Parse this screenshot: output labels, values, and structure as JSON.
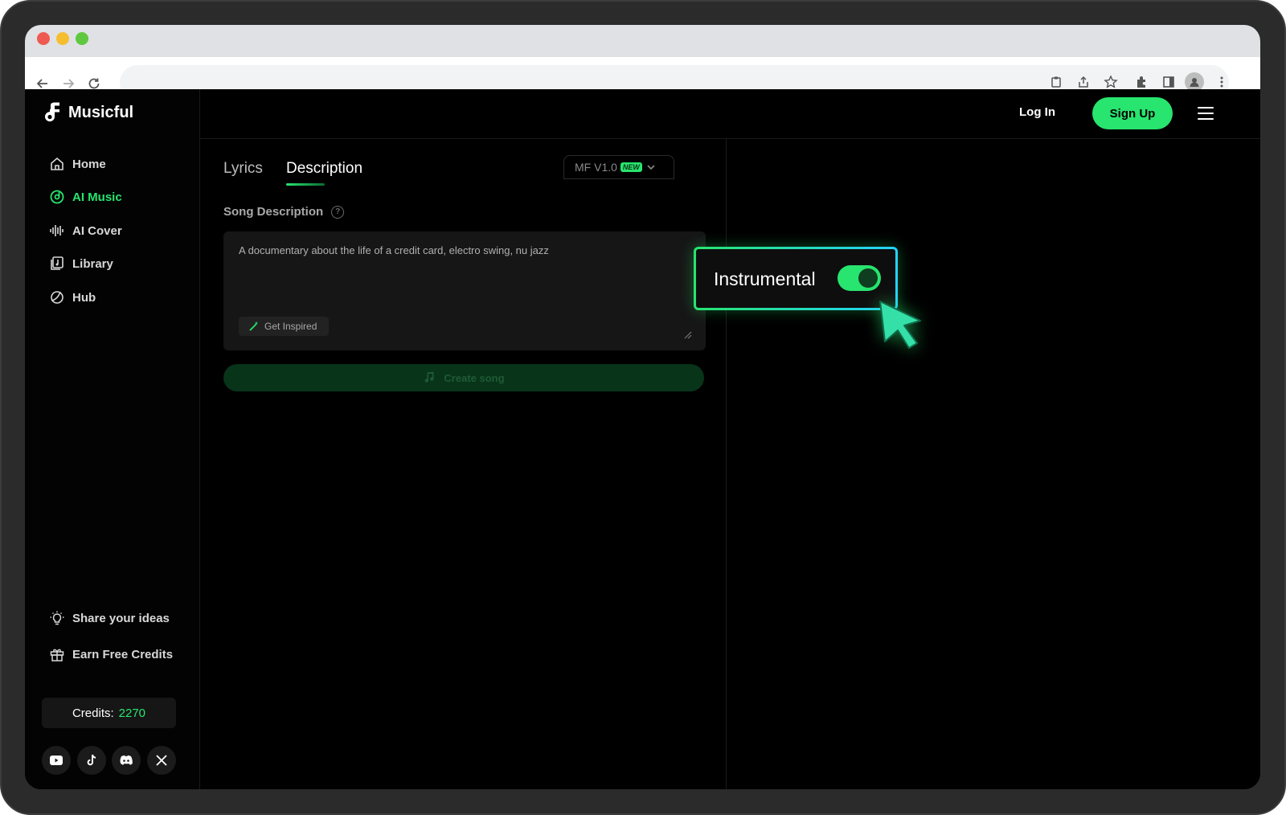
{
  "app": {
    "name": "Musicful",
    "accent_color": "#27e56e",
    "background_color": "#000000"
  },
  "browser": {
    "address": ""
  },
  "sidebar": {
    "items": [
      {
        "label": "Home",
        "icon": "home-icon"
      },
      {
        "label": "AI Music",
        "icon": "music-disc-icon",
        "active": true
      },
      {
        "label": "AI Cover",
        "icon": "soundwave-icon"
      },
      {
        "label": "Library",
        "icon": "library-icon"
      },
      {
        "label": "Hub",
        "icon": "hub-icon"
      }
    ],
    "bottom_items": [
      {
        "label": "Share your ideas",
        "icon": "lightbulb-icon"
      },
      {
        "label": "Earn Free Credits",
        "icon": "gift-icon"
      }
    ],
    "credits": {
      "label": "Credits:",
      "value": "2270"
    },
    "social": [
      "youtube-icon",
      "tiktok-icon",
      "discord-icon",
      "x-icon"
    ]
  },
  "header": {
    "login_label": "Log In",
    "signup_label": "Sign Up"
  },
  "main": {
    "tabs": [
      {
        "label": "Lyrics"
      },
      {
        "label": "Description",
        "active": true
      }
    ],
    "model": {
      "label": "MF V1.0",
      "badge": "NEW"
    },
    "song_description_label": "Song Description",
    "help_glyph": "?",
    "description_value": "A documentary about the life of a credit card, electro swing, nu jazz",
    "get_inspired_label": "Get Inspired",
    "create_label": "Create song"
  },
  "callout": {
    "label": "Instrumental",
    "toggle_on": true
  }
}
